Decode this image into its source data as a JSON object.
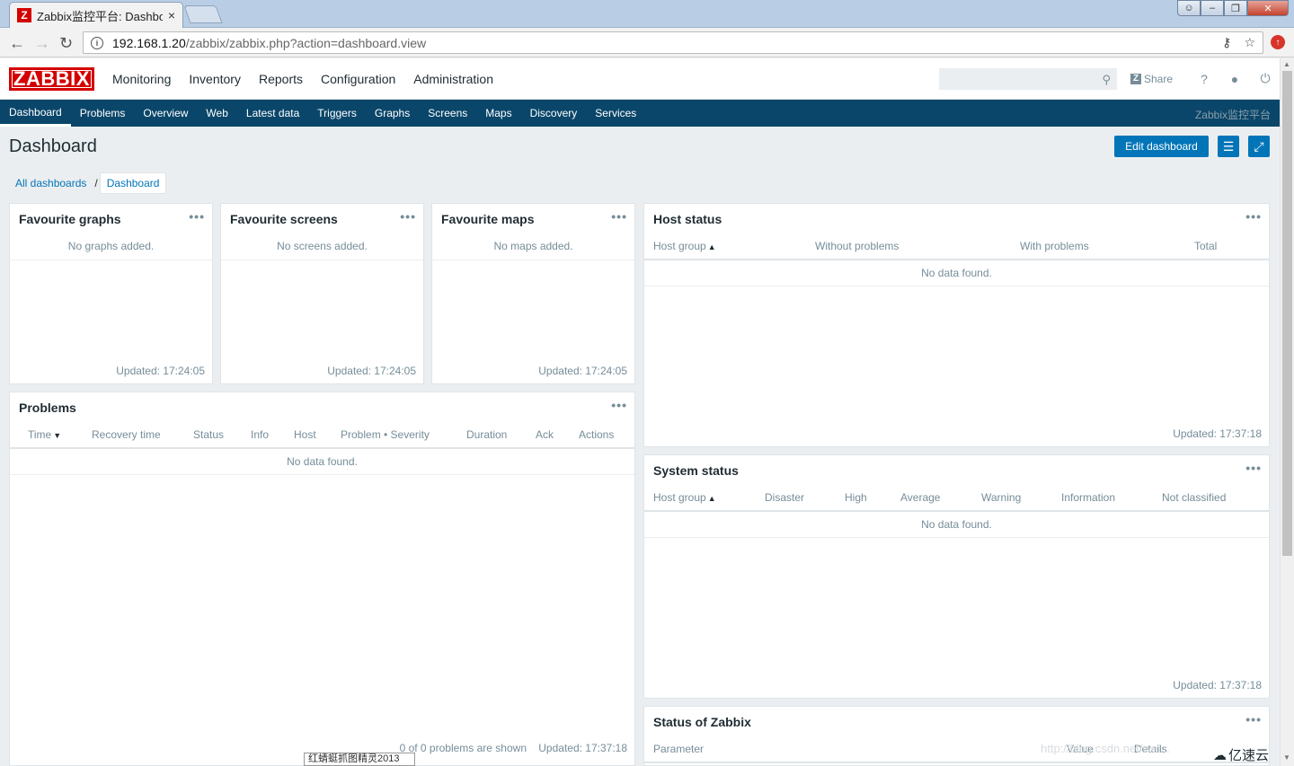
{
  "browser": {
    "tab_title": "Zabbix监控平台: Dashbo",
    "tab_favicon": "Z",
    "close_glyph": "×",
    "url_host": "192.168.1.20",
    "url_path": "/zabbix/zabbix.php?action=dashboard.view"
  },
  "header": {
    "logo": "ZABBIX",
    "menu": [
      "Monitoring",
      "Inventory",
      "Reports",
      "Configuration",
      "Administration"
    ],
    "active_menu": "Monitoring",
    "share_label": "Share",
    "help_glyph": "?"
  },
  "subnav": {
    "items": [
      "Dashboard",
      "Problems",
      "Overview",
      "Web",
      "Latest data",
      "Triggers",
      "Graphs",
      "Screens",
      "Maps",
      "Discovery",
      "Services"
    ],
    "active": "Dashboard",
    "server_name": "Zabbix监控平台"
  },
  "page": {
    "title": "Dashboard",
    "edit_button": "Edit dashboard",
    "breadcrumb": [
      "All dashboards",
      "Dashboard"
    ],
    "breadcrumb_separator": "/"
  },
  "widgets": {
    "fav_graphs": {
      "title": "Favourite graphs",
      "empty": "No graphs added.",
      "updated": "Updated: 17:24:05"
    },
    "fav_screens": {
      "title": "Favourite screens",
      "empty": "No screens added.",
      "updated": "Updated: 17:24:05"
    },
    "fav_maps": {
      "title": "Favourite maps",
      "empty": "No maps added.",
      "updated": "Updated: 17:24:05"
    },
    "problems": {
      "title": "Problems",
      "columns": [
        "Time",
        "Recovery time",
        "Status",
        "Info",
        "Host",
        "Problem • Severity",
        "Duration",
        "Ack",
        "Actions"
      ],
      "empty": "No data found.",
      "summary": "0 of 0 problems are shown",
      "updated": "Updated: 17:37:18"
    },
    "host_status": {
      "title": "Host status",
      "columns": [
        "Host group",
        "Without problems",
        "With problems",
        "Total"
      ],
      "empty": "No data found.",
      "updated": "Updated: 17:37:18"
    },
    "system_status": {
      "title": "System status",
      "columns": [
        "Host group",
        "Disaster",
        "High",
        "Average",
        "Warning",
        "Information",
        "Not classified"
      ],
      "empty": "No data found.",
      "updated": "Updated: 17:37:18"
    },
    "zabbix_status": {
      "title": "Status of Zabbix",
      "columns": [
        "Parameter",
        "Value",
        "Details"
      ]
    }
  },
  "overlay": {
    "watermark": "http://blog.csdn.net/wei...",
    "brand": "亿速云",
    "taskbar_tip": "红蜻蜓抓图精灵2013"
  },
  "icons": {
    "dots": "•••",
    "sort_up": "▲",
    "sort_down": "▼"
  }
}
